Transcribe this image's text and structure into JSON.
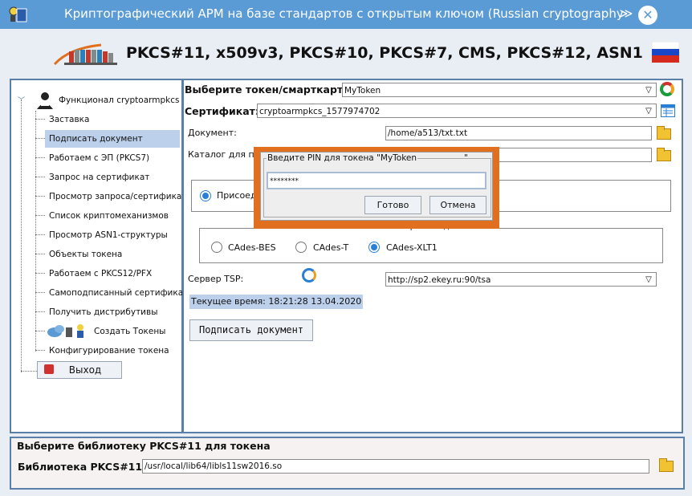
{
  "window": {
    "title": "Криптографический АРМ на базе стандартов с открытым ключом (Russian cryptography",
    "chevron": "≫",
    "close": "✕"
  },
  "header": {
    "title": "PKCS#11, x509v3, PKCS#10, PKCS#7, CMS, PKCS#12, ASN1"
  },
  "tree": {
    "root": "Функционал cryptoarmpkcs",
    "items": [
      "Заставка",
      "Подписать документ",
      "Работаем с ЭП (PKCS7)",
      "Запрос на сертификат",
      "Просмотр запроса/сертификата",
      "Список криптомеханизмов",
      "Просмотр ASN1-структуры",
      "Объекты токена",
      "Работаем с PKCS12/PFX",
      "Самоподписанный сертификат",
      "Получить дистрибутивы",
      "Создать Токены",
      "Конфигурирование токена"
    ],
    "exit_button": "Выход"
  },
  "main": {
    "token_label": "Выберите токен/смарткарту:",
    "token_value": "MyToken",
    "cert_label": "Сертификат:",
    "cert_value": "cryptoarmpkcs_1577974702",
    "doc_label": "Документ:",
    "doc_value": "/home/a513/txt.txt",
    "catalog_label": "Каталог для под",
    "attach_label": "Присоеди",
    "format_label": "Формат подписи",
    "formats": [
      "CAdes-BES",
      "CAdes-T",
      "CAdes-XLT1"
    ],
    "selected_format": "CAdes-XLT1",
    "tsp_label": "Сервер TSP:",
    "tsp_value": "http://sp2.ekey.ru:90/tsa",
    "time_text": "Текущее время: 18:21:28 13.04.2020",
    "sign_button": "Подписать документ"
  },
  "pin_dialog": {
    "title": "Введите PIN для токена \"MyToken",
    "title_tail": "\"",
    "pin_value": "********",
    "ok": "Готово",
    "cancel": "Отмена"
  },
  "library": {
    "group_title": "Выберите библиотеку PKCS#11 для токена",
    "label": "Библиотека PKCS#11:",
    "value": "/usr/local/lib64/libls11sw2016.so"
  },
  "colors": {
    "titlebar": "#5a9bd5",
    "panel_border": "#5a7fa8",
    "modal_highlight": "#e07020",
    "selection": "#bcd0ec"
  }
}
